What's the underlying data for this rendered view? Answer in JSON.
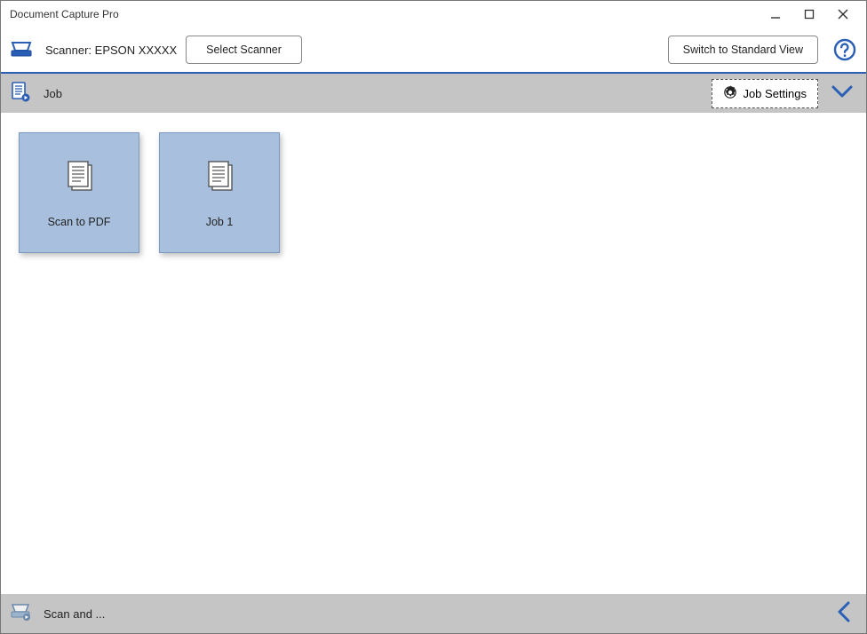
{
  "window": {
    "title": "Document Capture Pro"
  },
  "toolbar": {
    "scanner_label_prefix": "Scanner: ",
    "scanner_name": "EPSON XXXXX",
    "select_scanner_label": "Select Scanner",
    "switch_view_label": "Switch to Standard View"
  },
  "section": {
    "title": "Job",
    "job_settings_label": "Job Settings"
  },
  "jobs": [
    {
      "label": "Scan to PDF"
    },
    {
      "label": "Job 1"
    }
  ],
  "footer": {
    "title": "Scan and ..."
  },
  "colors": {
    "accent": "#2a5fb5",
    "tile_bg": "#a8c0de",
    "bar_bg": "#c5c5c5"
  }
}
